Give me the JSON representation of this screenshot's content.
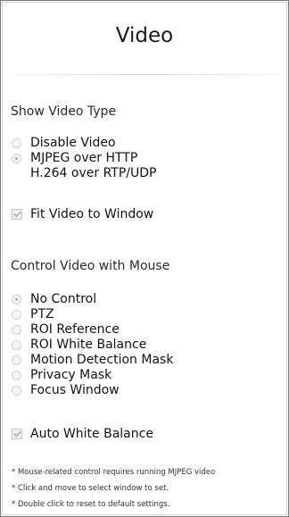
{
  "panel": {
    "title": "Video",
    "show_video_type": {
      "heading": "Show Video Type",
      "options": [
        {
          "label": "Disable Video",
          "checked": false
        },
        {
          "label": "MJPEG over HTTP",
          "checked": true
        },
        {
          "label": "H.264 over RTP/UDP",
          "checked": false
        }
      ],
      "fit_video": {
        "label": "Fit Video to Window",
        "checked": true
      }
    },
    "control_video": {
      "heading": "Control Video with Mouse",
      "options": [
        {
          "label": "No Control",
          "checked": true
        },
        {
          "label": "PTZ",
          "checked": false
        },
        {
          "label": "ROI Reference",
          "checked": false
        },
        {
          "label": "ROI White Balance",
          "checked": false
        },
        {
          "label": "Motion Detection Mask",
          "checked": false
        },
        {
          "label": "Privacy Mask",
          "checked": false
        },
        {
          "label": "Focus Window",
          "checked": false
        }
      ],
      "auto_white_balance": {
        "label": "Auto White Balance",
        "checked": true
      }
    },
    "notes": [
      "* Mouse-related control requires running MJPEG video",
      "* Click and move to select window to set.",
      "* Double click to reset to default settings."
    ]
  }
}
